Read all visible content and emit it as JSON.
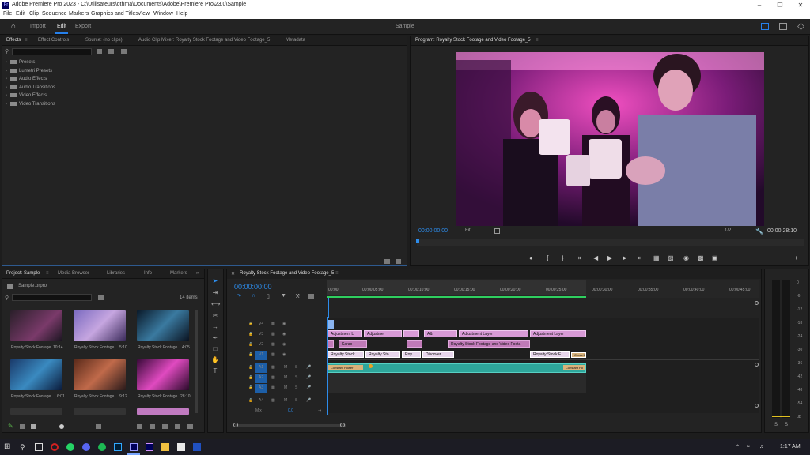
{
  "titlebar": {
    "title": "Adobe Premiere Pro 2023 - C:\\Utilisateurs\\othma\\Documents\\Adobe\\Premiere Pro\\23.0\\Sample",
    "app_abbr": "Pr"
  },
  "menu": [
    "File",
    "Edit",
    "Clip",
    "Sequence",
    "Markers",
    "Graphics and Titles",
    "View",
    "Window",
    "Help"
  ],
  "header": {
    "tabs": [
      "Import",
      "Edit",
      "Export"
    ],
    "project_name": "Sample"
  },
  "effects_panel": {
    "tabs": [
      "Effects",
      "Effect Controls",
      "Source: (no clips)",
      "Audio Clip Mixer: Royalty Stock Footage and Video Footage_5",
      "Metadata"
    ],
    "folders": [
      "Presets",
      "Lumetri Presets",
      "Audio Effects",
      "Audio Transitions",
      "Video Effects",
      "Video Transitions"
    ]
  },
  "program": {
    "title": "Program: Royalty Stock Footage and Video Footage_5",
    "timecode": "00:00:00:00",
    "fit": "Fit",
    "resolution": "1/2",
    "duration": "00:00:28:10"
  },
  "project": {
    "tabs": [
      "Project: Sample",
      "Media Browser",
      "Libraries",
      "Info",
      "Markers"
    ],
    "file": "Sample.prproj",
    "items": "14 items",
    "clips": [
      {
        "name": "Royalty Stock Footage...",
        "dur": "10:14"
      },
      {
        "name": "Royalty Stock Footage...",
        "dur": "5:10"
      },
      {
        "name": "Royalty Stock Footage...",
        "dur": "4:05"
      },
      {
        "name": "Royalty Stock Footage...",
        "dur": "6:01"
      },
      {
        "name": "Royalty Stock Footage...",
        "dur": "9:12"
      },
      {
        "name": "Royalty Stock Footage...",
        "dur": "28:10"
      }
    ]
  },
  "timeline": {
    "title": "Royalty Stock Footage and Video Footage_5",
    "timecode": "00:00:00:00",
    "ruler": [
      "00:00",
      "00:00:05:00",
      "00:00:10:00",
      "00:00:15:00",
      "00:00:20:00",
      "00:00:25:00",
      "00:00:30:00",
      "00:00:35:00",
      "00:00:40:00",
      "00:00:45:00"
    ],
    "video_tracks": [
      "V4",
      "V3",
      "V2",
      "V1"
    ],
    "audio_tracks": [
      "A1",
      "A2",
      "A3",
      "A4"
    ],
    "mix_label": "Mix",
    "mix_value": "0.0",
    "v3_clips": [
      "Adjustment L",
      "Adjustme",
      "A&",
      "Adjustment Layer",
      "Adjustment Layer"
    ],
    "v2_clips": [
      "Karao",
      "Royalty Stock Footage and Video Foota"
    ],
    "v1_clips": [
      "Royalty Stock",
      "Royalty Sto",
      "Roy",
      "Discover",
      "Royalty Stock F",
      "Cross Zo"
    ],
    "a1_clips": [
      "Constant Power",
      "Constant Po"
    ]
  },
  "meter": {
    "labels": [
      "0",
      "-6",
      "-12",
      "-18",
      "-24",
      "-30",
      "-36",
      "-42",
      "-48",
      "-54",
      "dB"
    ],
    "solo": [
      "S",
      "S"
    ]
  },
  "taskbar": {
    "clock": "1:17 AM"
  }
}
